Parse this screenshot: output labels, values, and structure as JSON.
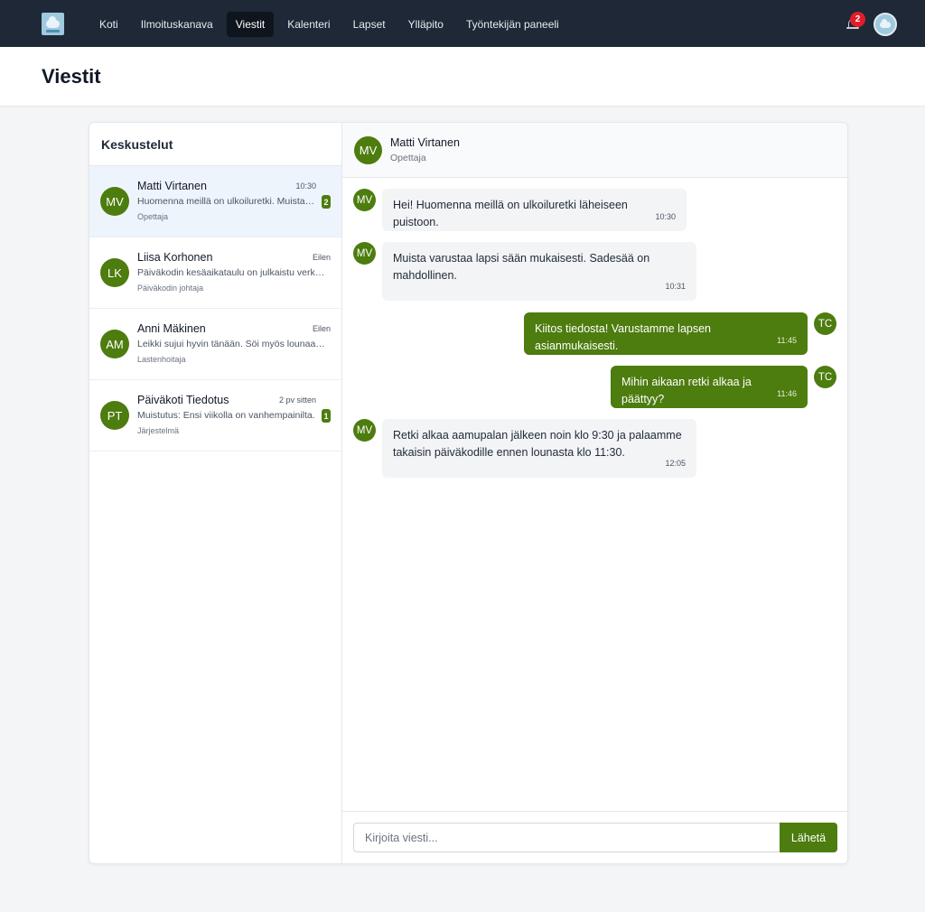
{
  "nav": {
    "items": [
      {
        "label": "Koti",
        "active": false
      },
      {
        "label": "Ilmoituskanava",
        "active": false
      },
      {
        "label": "Viestit",
        "active": true
      },
      {
        "label": "Kalenteri",
        "active": false
      },
      {
        "label": "Lapset",
        "active": false
      },
      {
        "label": "Ylläpito",
        "active": false
      },
      {
        "label": "Työntekijän paneeli",
        "active": false
      }
    ],
    "notification_count": "2",
    "bell_icon": "bell-icon",
    "logo_icon": "cloud-logo-icon"
  },
  "page": {
    "title": "Viestit"
  },
  "sidebar": {
    "title": "Keskustelut",
    "conversations": [
      {
        "initials": "MV",
        "name": "Matti Virtanen",
        "time": "10:30",
        "preview": "Huomenna meillä on ulkoiluretki. Muista varustaa lapsi sään mukaisesti.",
        "role": "Opettaja",
        "unread": "2",
        "selected": true
      },
      {
        "initials": "LK",
        "name": "Liisa Korhonen",
        "time": "Eilen",
        "preview": "Päiväkodin kesäaikataulu on julkaistu verkkosivuilla.",
        "role": "Päiväkodin johtaja",
        "unread": "",
        "selected": false
      },
      {
        "initials": "AM",
        "name": "Anni Mäkinen",
        "time": "Eilen",
        "preview": "Leikki sujui hyvin tänään. Söi myös lounaan hyvin.",
        "role": "Lastenhoitaja",
        "unread": "",
        "selected": false
      },
      {
        "initials": "PT",
        "name": "Päiväkoti Tiedotus",
        "time": "2 pv sitten",
        "preview": "Muistutus: Ensi viikolla on vanhempainilta.",
        "role": "Järjestelmä",
        "unread": "1",
        "selected": false
      }
    ]
  },
  "chat": {
    "header": {
      "initials": "MV",
      "name": "Matti Virtanen",
      "role": "Opettaja"
    },
    "messages": [
      {
        "direction": "in",
        "initials": "MV",
        "lines": [
          "Hei! Huomenna meillä on ulkoiluretki läheiseen puistoon."
        ],
        "time": "10:30"
      },
      {
        "direction": "in",
        "initials": "MV",
        "lines": [
          "Muista varustaa lapsi sään mukaisesti. Sadesää on",
          "mahdollinen."
        ],
        "time": "10:31"
      },
      {
        "direction": "out",
        "initials": "TC",
        "lines": [
          "Kiitos tiedosta! Varustamme lapsen asianmukaisesti."
        ],
        "time": "11:45"
      },
      {
        "direction": "out",
        "initials": "TC",
        "lines": [
          "Mihin aikaan retki alkaa ja päättyy?"
        ],
        "time": "11:46"
      },
      {
        "direction": "in",
        "initials": "MV",
        "lines": [
          "Retki alkaa aamupalan jälkeen noin klo 9:30 ja palaamme",
          "takaisin päiväkodille ennen lounasta klo 11:30."
        ],
        "time": "12:05"
      }
    ],
    "composer": {
      "placeholder": "Kirjoita viesti...",
      "value": "",
      "send_label": "Lähetä"
    }
  },
  "colors": {
    "nav_bg": "#1e2836",
    "accent_green": "#4d7c0f",
    "badge_red": "#e11d2a",
    "selected_row": "#eef4fc"
  }
}
